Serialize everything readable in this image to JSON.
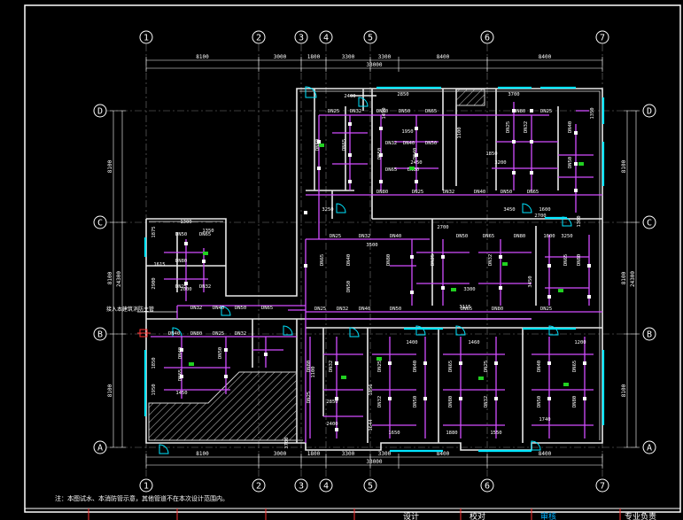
{
  "axes": {
    "top": [
      "1",
      "2",
      "3",
      "4",
      "5",
      "6",
      "7"
    ],
    "bottom": [
      "1",
      "2",
      "3",
      "4",
      "5",
      "6",
      "7"
    ],
    "left": [
      "D",
      "C",
      "B",
      "A"
    ],
    "right": [
      "D",
      "C",
      "B",
      "A"
    ]
  },
  "dimensions": {
    "top_spans": [
      "8100",
      "3000",
      "1800",
      "3300",
      "3300",
      "8400",
      "8400"
    ],
    "top_total": "33000",
    "bottom_spans": [
      "8100",
      "3000",
      "1800",
      "3300",
      "3300",
      "8400",
      "8400"
    ],
    "bottom_total": "33000",
    "left_spans": [
      "8100",
      "8100",
      "8100"
    ],
    "left_total": "24300",
    "right_spans": [
      "8100",
      "8100",
      "8100"
    ],
    "right_total": "24300"
  },
  "pipes": [
    {
      "label": "DN25"
    },
    {
      "label": "DN32"
    },
    {
      "label": "DN40"
    },
    {
      "label": "DN50"
    },
    {
      "label": "DN65"
    },
    {
      "label": "DN80"
    }
  ],
  "room_dims": [
    "2850",
    "2400",
    "1450",
    "1950",
    "1850",
    "3700",
    "1100",
    "3450",
    "1600",
    "3250",
    "2700",
    "1300",
    "1350",
    "1875",
    "1615",
    "2900",
    "2000",
    "2450",
    "3200",
    "3500",
    "3300",
    "3115",
    "1650",
    "1880",
    "1550",
    "1644",
    "1856",
    "1400",
    "1460",
    "1200",
    "1740"
  ],
  "note": "注：本图试水、本消防管示意，其他管道不在本次设计范围内。",
  "callout": "接入本建筑消防主管",
  "title_bar": [
    "设计",
    "校对",
    "审核",
    "专业负责"
  ]
}
